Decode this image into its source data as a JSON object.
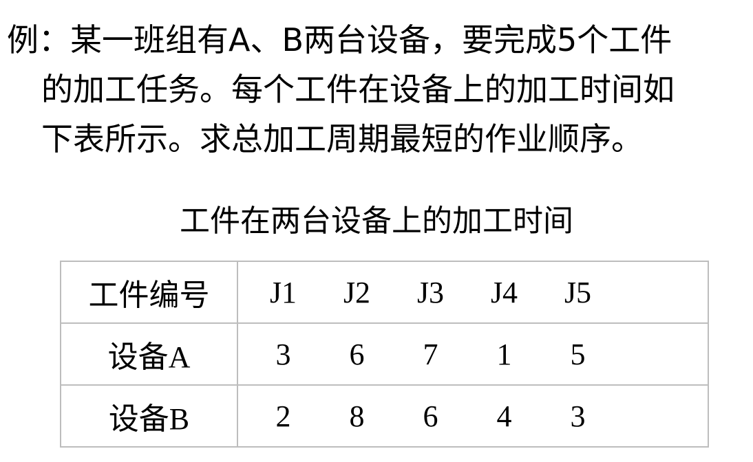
{
  "problem": {
    "lines": [
      "例：某一班组有A、B两台设备，要完成5个工件",
      "的加工任务。每个工件在设备上的加工时间如",
      "下表所示。求总加工周期最短的作业顺序。"
    ]
  },
  "table": {
    "caption": "工件在两台设备上的加工时间",
    "header_label": "工件编号",
    "jobs": [
      "J1",
      "J2",
      "J3",
      "J4",
      "J5"
    ],
    "rows": [
      {
        "label": "设备A",
        "values": [
          "3",
          "6",
          "7",
          "1",
          "5"
        ]
      },
      {
        "label": "设备B",
        "values": [
          "2",
          "8",
          "6",
          "4",
          "3"
        ]
      }
    ]
  }
}
